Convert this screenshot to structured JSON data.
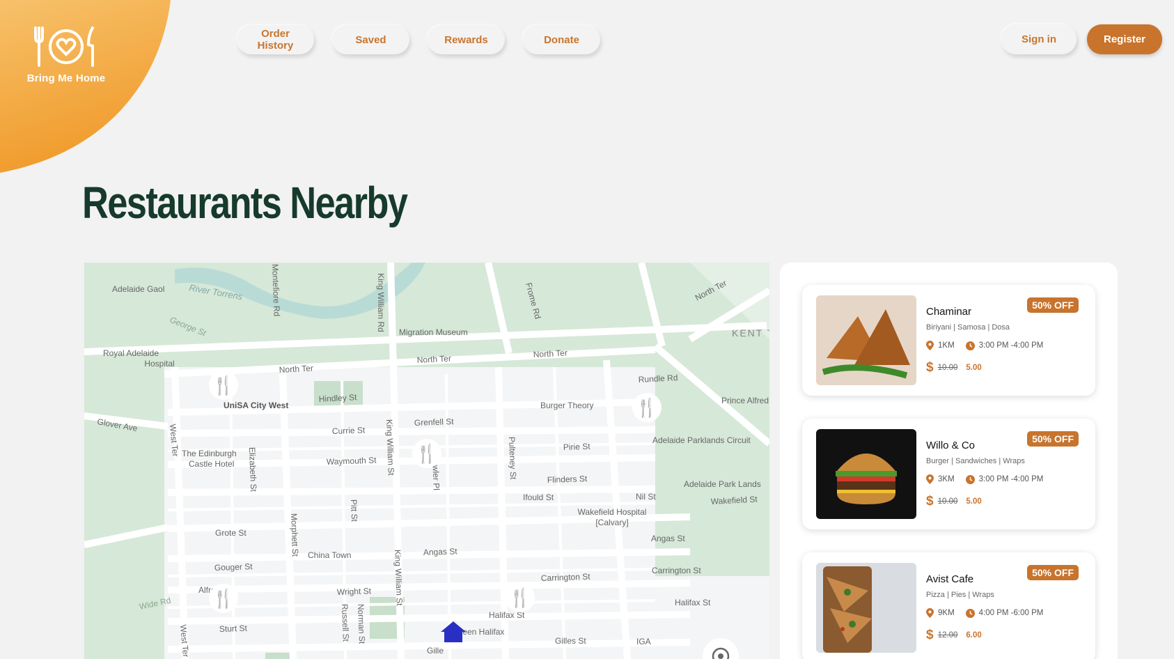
{
  "brand": {
    "name": "Bring Me Home",
    "logo_icon": "plate-fork-knife-heart-icon",
    "color": "#f2a137"
  },
  "nav": {
    "items": [
      {
        "label": "Order History"
      },
      {
        "label": "Saved"
      },
      {
        "label": "Rewards"
      },
      {
        "label": "Donate"
      }
    ],
    "sign_in": "Sign in",
    "register": "Register"
  },
  "page": {
    "title": "Restaurants Nearby"
  },
  "map": {
    "street_labels": [
      "North Ter",
      "Hindley St",
      "Currie St",
      "Grenfell St",
      "Waymouth St",
      "Pirie St",
      "Flinders St",
      "Grote St",
      "Angas St",
      "Gouger St",
      "Carrington St",
      "Wright St",
      "Halifax St",
      "Sturt St",
      "Gilles St",
      "Rundle Rd",
      "Glover Ave",
      "West Ter",
      "King William St",
      "Frome Rd",
      "Pulteney St",
      "Gawler Pl",
      "Morphett St",
      "Pitt St",
      "Elizabeth St",
      "George St",
      "River Torrens",
      "Wide Rd",
      "Ifould St",
      "Nil St",
      "Russell St",
      "Norman St",
      "Wakefield St",
      "Montefiore Rd",
      "King William Rd"
    ],
    "places": [
      "Adelaide Gaol",
      "Royal Adelaide Hospital",
      "UniSA City West",
      "The Edinburgh Castle Hotel",
      "Migration Museum",
      "Burger Theory",
      "China Town",
      "Wakefield Hospital [Calvary]",
      "Adelaide Parklands Circuit",
      "Adelaide Park Lands",
      "Prince Alfred",
      "KENT T",
      "IGA",
      "Green Halifax",
      "Alfre",
      "Gille"
    ],
    "marker_icon": "restaurant-marker-icon",
    "home_icon": "home-icon"
  },
  "restaurants": [
    {
      "name": "Chaminar",
      "discount": "50% OFF",
      "cuisines": "Biriyani | Samosa | Dosa",
      "distance": "1KM",
      "time": "3:00 PM -4:00 PM",
      "old_price": "10.00",
      "new_price": "5.00",
      "image": "samosa-photo"
    },
    {
      "name": "Willo & Co",
      "discount": "50% OFF",
      "cuisines": "Burger | Sandwiches | Wraps",
      "distance": "3KM",
      "time": "3:00 PM -4:00 PM",
      "old_price": "10.00",
      "new_price": "5.00",
      "image": "burger-photo"
    },
    {
      "name": "Avist Cafe",
      "discount": "50% OFF",
      "cuisines": "Pizza | Pies | Wraps",
      "distance": "9KM",
      "time": "4:00 PM -6:00 PM",
      "old_price": "12.00",
      "new_price": "6.00",
      "image": "pizza-photo"
    }
  ],
  "currency_symbol": "$",
  "colors": {
    "accent": "#c8742d",
    "title": "#163a2c",
    "background": "#f2f2f2",
    "park": "#d3e6d5",
    "water": "#bcdcd9",
    "home": "#2a2fc4"
  }
}
